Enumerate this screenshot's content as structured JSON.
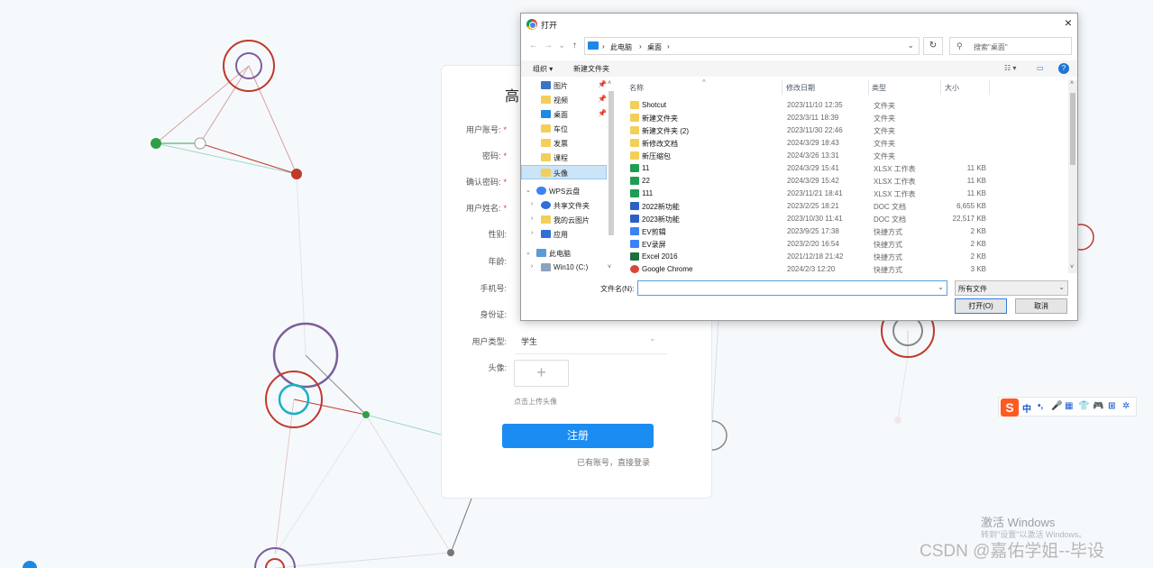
{
  "register_form": {
    "title": "高",
    "fields": [
      {
        "label": "用户账号:",
        "required": true
      },
      {
        "label": "密码:",
        "required": true
      },
      {
        "label": "确认密码:",
        "required": true
      },
      {
        "label": "用户姓名:",
        "required": true
      },
      {
        "label": "性别:",
        "required": false
      },
      {
        "label": "年龄:",
        "required": false
      },
      {
        "label": "手机号:",
        "required": false
      },
      {
        "label": "身份证:",
        "required": false
      },
      {
        "label": "用户类型:",
        "required": false,
        "value": "学生"
      },
      {
        "label": "头像:",
        "required": false
      }
    ],
    "required_mark": "*",
    "user_type_value": "学生",
    "avatar_plus": "+",
    "avatar_hint": "点击上传头像",
    "register_button": "注册",
    "login_link": "已有账号，直接登录",
    "primary_color": "#1b8cf2"
  },
  "dialog": {
    "title": "打开",
    "close": "×",
    "nav": {
      "back": "←",
      "forward": "→",
      "dropdown": "⌄",
      "up": "↑"
    },
    "breadcrumb": [
      "此电脑",
      "桌面"
    ],
    "breadcrumb_sep": "›",
    "refresh": "↻",
    "search_placeholder": "搜索\"桌面\"",
    "toolbar": {
      "organize": "组织 ▾",
      "new_folder": "新建文件夹",
      "help": "?"
    },
    "tree": [
      {
        "label": "图片",
        "icon": "pictures-icon",
        "pinned": true
      },
      {
        "label": "视频",
        "icon": "folder-icon",
        "pinned": true
      },
      {
        "label": "桌面",
        "icon": "desktop-icon",
        "pinned": true
      },
      {
        "label": "车位",
        "icon": "folder-icon",
        "pinned": false
      },
      {
        "label": "发票",
        "icon": "folder-icon",
        "pinned": false
      },
      {
        "label": "课程",
        "icon": "folder-icon",
        "pinned": false
      },
      {
        "label": "头像",
        "icon": "folder-icon",
        "pinned": false,
        "selected": true
      },
      {
        "label": "WPS云盘",
        "icon": "cloud-icon",
        "pinned": false,
        "expanded": true
      },
      {
        "label": "共享文件夹",
        "icon": "share-icon",
        "pinned": false
      },
      {
        "label": "我的云图片",
        "icon": "folder-icon",
        "pinned": false
      },
      {
        "label": "应用",
        "icon": "apps-icon",
        "pinned": false
      },
      {
        "label": "此电脑",
        "icon": "computer-icon",
        "pinned": false,
        "expanded": true
      },
      {
        "label": "Win10 (C:)",
        "icon": "drive-icon",
        "pinned": false
      }
    ],
    "columns": {
      "name": "名称",
      "date": "修改日期",
      "type": "类型",
      "size": "大小"
    },
    "files": [
      {
        "name": "Shotcut",
        "date": "2023/11/10 12:35",
        "type": "文件夹",
        "size": "",
        "icon": "folder-icon"
      },
      {
        "name": "新建文件夹",
        "date": "2023/3/11 18:39",
        "type": "文件夹",
        "size": "",
        "icon": "folder-icon"
      },
      {
        "name": "新建文件夹 (2)",
        "date": "2023/11/30 22:46",
        "type": "文件夹",
        "size": "",
        "icon": "folder-icon"
      },
      {
        "name": "新修改文档",
        "date": "2024/3/29 18:43",
        "type": "文件夹",
        "size": "",
        "icon": "folder-icon"
      },
      {
        "name": "新压缩包",
        "date": "2024/3/26 13:31",
        "type": "文件夹",
        "size": "",
        "icon": "folder-icon"
      },
      {
        "name": "11",
        "date": "2024/3/29 15:41",
        "type": "XLSX 工作表",
        "size": "11 KB",
        "icon": "xlsx-icon"
      },
      {
        "name": "22",
        "date": "2024/3/29 15:42",
        "type": "XLSX 工作表",
        "size": "11 KB",
        "icon": "xlsx-icon"
      },
      {
        "name": "111",
        "date": "2023/11/21 18:41",
        "type": "XLSX 工作表",
        "size": "11 KB",
        "icon": "xlsx-icon"
      },
      {
        "name": "2022新功能",
        "date": "2023/2/25 18:21",
        "type": "DOC 文档",
        "size": "6,655 KB",
        "icon": "doc-icon"
      },
      {
        "name": "2023新功能",
        "date": "2023/10/30 11:41",
        "type": "DOC 文档",
        "size": "22,517 KB",
        "icon": "doc-icon"
      },
      {
        "name": "EV剪辑",
        "date": "2023/9/25 17:38",
        "type": "快捷方式",
        "size": "2 KB",
        "icon": "shortcut-icon"
      },
      {
        "name": "EV录屏",
        "date": "2023/2/20 16:54",
        "type": "快捷方式",
        "size": "2 KB",
        "icon": "shortcut-icon"
      },
      {
        "name": "Excel 2016",
        "date": "2021/12/18 21:42",
        "type": "快捷方式",
        "size": "2 KB",
        "icon": "excel-icon"
      },
      {
        "name": "Google Chrome",
        "date": "2024/2/3 12:20",
        "type": "快捷方式",
        "size": "3 KB",
        "icon": "chrome-icon"
      }
    ],
    "filename_label": "文件名(N):",
    "filename_value": "",
    "filter_value": "所有文件",
    "open_button": "打开(O)",
    "cancel_button": "取消"
  },
  "ime": {
    "logo": "S",
    "buttons": [
      "中",
      "•,",
      "🎤",
      "▦",
      "👕",
      "🎮",
      "⊞",
      "✲"
    ]
  },
  "watermark": {
    "activate_title": "激活 Windows",
    "activate_sub": "转到\"设置\"以激活 Windows。",
    "csdn": "CSDN @嘉佑学姐--毕设"
  },
  "colors": {
    "node_red": "#c0392b",
    "node_purple": "#7b5e9b",
    "node_green": "#2ea043",
    "node_teal": "#1ab0c8"
  }
}
